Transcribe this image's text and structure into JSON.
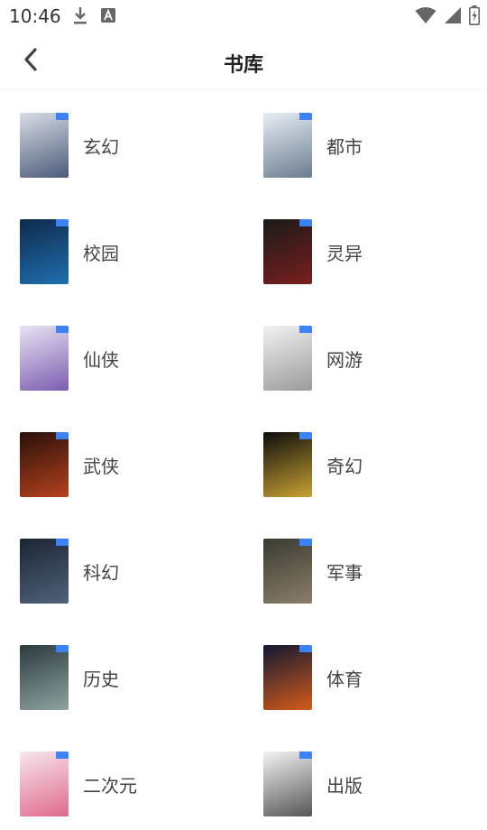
{
  "status_bar": {
    "time": "10:46",
    "icons": [
      "download-icon",
      "font-icon",
      "wifi-icon",
      "signal-icon",
      "battery-charging-icon"
    ]
  },
  "header": {
    "title": "书库",
    "back_icon": "chevron-left-icon"
  },
  "categories": [
    {
      "label": "玄幻",
      "colors": [
        "#d9dde6",
        "#4b5b7a"
      ]
    },
    {
      "label": "都市",
      "colors": [
        "#e8eef5",
        "#6b7c8f"
      ]
    },
    {
      "label": "校园",
      "colors": [
        "#0f2a4a",
        "#1f6fb0"
      ]
    },
    {
      "label": "灵异",
      "colors": [
        "#1a1a1a",
        "#7a1e1e"
      ]
    },
    {
      "label": "仙侠",
      "colors": [
        "#e9e3f4",
        "#7a5db0"
      ]
    },
    {
      "label": "网游",
      "colors": [
        "#f2f2f2",
        "#9a9a9a"
      ]
    },
    {
      "label": "武侠",
      "colors": [
        "#2a0f0a",
        "#b5421c"
      ]
    },
    {
      "label": "奇幻",
      "colors": [
        "#0c0c0c",
        "#c9a233"
      ]
    },
    {
      "label": "科幻",
      "colors": [
        "#1b2533",
        "#50627a"
      ]
    },
    {
      "label": "军事",
      "colors": [
        "#3a3a32",
        "#8a7f6a"
      ]
    },
    {
      "label": "历史",
      "colors": [
        "#2b3a3e",
        "#8fa3a0"
      ]
    },
    {
      "label": "体育",
      "colors": [
        "#101830",
        "#d65a1c"
      ]
    },
    {
      "label": "二次元",
      "colors": [
        "#f7e6ee",
        "#e06a8c"
      ]
    },
    {
      "label": "出版",
      "colors": [
        "#f4f4f4",
        "#555555"
      ]
    }
  ]
}
